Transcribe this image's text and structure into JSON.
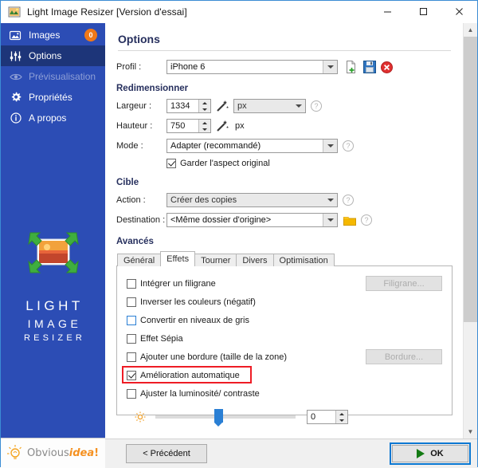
{
  "window": {
    "title": "Light Image Resizer  [Version d'essai]",
    "app_icon": "app-image-icon",
    "minimize_label": "—",
    "maximize_label": "☐",
    "close_label": "✕"
  },
  "sidebar": {
    "items": [
      {
        "label": "Images",
        "icon": "picture-icon",
        "badge": "0",
        "state": "normal"
      },
      {
        "label": "Options",
        "icon": "sliders-icon",
        "badge": "",
        "state": "active"
      },
      {
        "label": "Prévisualisation",
        "icon": "eye-icon",
        "badge": "",
        "state": "disabled"
      },
      {
        "label": "Propriétés",
        "icon": "gear-icon",
        "badge": "",
        "state": "normal"
      },
      {
        "label": "A propos",
        "icon": "info-icon",
        "badge": "",
        "state": "normal"
      }
    ],
    "brand": {
      "line1": "LIGHT",
      "line2": "IMAGE",
      "line3": "RESIZER"
    },
    "vendor": {
      "prefix": "Obvious",
      "accent": "idea",
      "suffix": "!"
    },
    "colors": {
      "sidebar_bg": "#2c4db5",
      "active_bg": "#1d3579",
      "badge_bg": "#f07818"
    }
  },
  "main": {
    "page_title": "Options",
    "profile": {
      "label": "Profil :",
      "value": "iPhone 6",
      "new_icon": "new-file-icon",
      "save_icon": "save-disk-icon",
      "delete_icon": "delete-circle-icon"
    },
    "resize": {
      "heading": "Redimensionner",
      "width": {
        "label": "Largeur :",
        "value": "1334",
        "unit": "px",
        "wand_icon": "magic-wand-icon",
        "help_icon": "help-icon"
      },
      "height": {
        "label": "Hauteur :",
        "value": "750",
        "unit": "px",
        "wand_icon": "magic-wand-icon"
      },
      "mode": {
        "label": "Mode :",
        "value": "Adapter (recommandé)",
        "help_icon": "help-icon"
      },
      "keep_aspect": {
        "label": "Garder l'aspect original",
        "checked": true
      }
    },
    "target": {
      "heading": "Cible",
      "action": {
        "label": "Action :",
        "value": "Créer des copies",
        "help_icon": "help-icon"
      },
      "destination": {
        "label": "Destination :",
        "value": "<Même dossier d'origine>",
        "folder_icon": "folder-icon",
        "help_icon": "help-icon"
      }
    },
    "advanced": {
      "heading": "Avancés",
      "tabs": [
        {
          "label": "Général",
          "active": false
        },
        {
          "label": "Effets",
          "active": true
        },
        {
          "label": "Tourner",
          "active": false
        },
        {
          "label": "Divers",
          "active": false
        },
        {
          "label": "Optimisation",
          "active": false
        }
      ],
      "effects": [
        {
          "label": "Intégrer un filigrane",
          "checked": false,
          "highlight": false,
          "button": "Filigrane..."
        },
        {
          "label": "Inverser les couleurs (négatif)",
          "checked": false,
          "highlight": false,
          "button": ""
        },
        {
          "label": "Convertir en niveaux de gris",
          "checked": false,
          "highlight": false,
          "hover": true,
          "button": ""
        },
        {
          "label": "Effet Sépia",
          "checked": false,
          "highlight": false,
          "button": ""
        },
        {
          "label": "Ajouter une bordure (taille de la zone)",
          "checked": false,
          "highlight": false,
          "button": "Bordure..."
        },
        {
          "label": "Amélioration automatique",
          "checked": true,
          "highlight": true,
          "button": ""
        },
        {
          "label": "Ajuster la luminosité/ contraste",
          "checked": false,
          "highlight": false,
          "button": ""
        }
      ],
      "slider": {
        "icon": "brightness-sun-icon",
        "value": "0",
        "position_percent": 42
      },
      "highlight_color": "#ee1c25"
    }
  },
  "footer": {
    "previous_label": "< Précédent",
    "ok_label": "OK",
    "ok_icon": "play-triangle-icon"
  },
  "scrollbar": {
    "up_arrow": "▲",
    "down_arrow": "▼"
  }
}
